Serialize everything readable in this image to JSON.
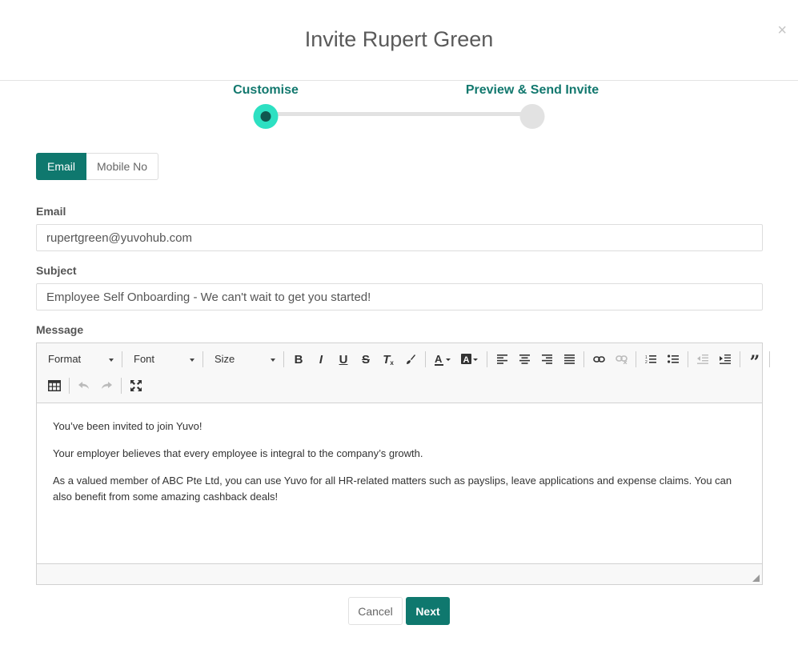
{
  "modal": {
    "title": "Invite Rupert Green",
    "close_icon": "×"
  },
  "stepper": {
    "steps": [
      {
        "label": "Customise",
        "state": "active"
      },
      {
        "label": "Preview & Send Invite",
        "state": "inactive"
      }
    ],
    "colors": {
      "active": "#2de0c2",
      "active_inner": "#10584f",
      "label": "#12786e"
    }
  },
  "contact_toggle": {
    "options": [
      "Email",
      "Mobile No"
    ],
    "selected": "Email"
  },
  "form": {
    "email_label": "Email",
    "email_value": "rupertgreen@yuvohub.com",
    "subject_label": "Subject",
    "subject_value": "Employee Self Onboarding - We can't wait to get you started!",
    "message_label": "Message"
  },
  "editor": {
    "format_label": "Format",
    "font_label": "Font",
    "size_label": "Size",
    "toolbar_icons": [
      "bold-icon",
      "italic-icon",
      "underline-icon",
      "strikethrough-icon",
      "remove-format-icon",
      "copy-format-icon",
      "text-color-icon",
      "background-color-icon",
      "align-left-icon",
      "align-center-icon",
      "align-right-icon",
      "justify-icon",
      "link-icon",
      "unlink-icon",
      "numbered-list-icon",
      "bulleted-list-icon",
      "outdent-icon",
      "indent-icon",
      "blockquote-icon",
      "table-icon",
      "undo-icon",
      "redo-icon",
      "maximize-icon"
    ],
    "paragraphs": [
      "You’ve been invited to join Yuvo!",
      "Your employer believes that every employee is integral to the company’s growth.",
      "As a valued member of ABC Pte Ltd, you can use Yuvo for all HR-related matters such as payslips, leave applications and expense claims. You can also benefit from some amazing cashback deals!"
    ]
  },
  "actions": {
    "cancel_label": "Cancel",
    "next_label": "Next"
  },
  "colors": {
    "primary": "#0f786e"
  }
}
